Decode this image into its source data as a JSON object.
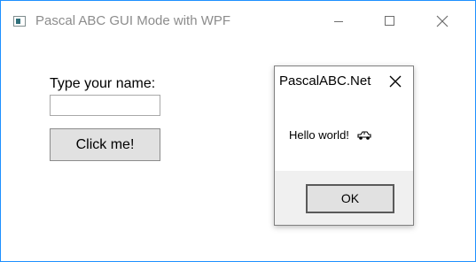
{
  "window": {
    "title": "Pascal ABC GUI Mode with WPF",
    "app_icon": "app-window-icon",
    "controls": [
      "minimize-icon",
      "maximize-icon",
      "close-icon"
    ]
  },
  "form": {
    "name_label": "Type your name:",
    "name_value": "",
    "button_label": "Click me!"
  },
  "dialog": {
    "title": "PascalABC.Net",
    "message": "Hello world!",
    "message_icon": "car-icon",
    "ok_label": "OK"
  },
  "colors": {
    "desktop_accent": "#1e90ff",
    "window_bg": "#ffffff",
    "title_text": "#8c8c8c",
    "button_bg": "#e1e1e1",
    "dialog_footer_bg": "#f0f0f0"
  }
}
